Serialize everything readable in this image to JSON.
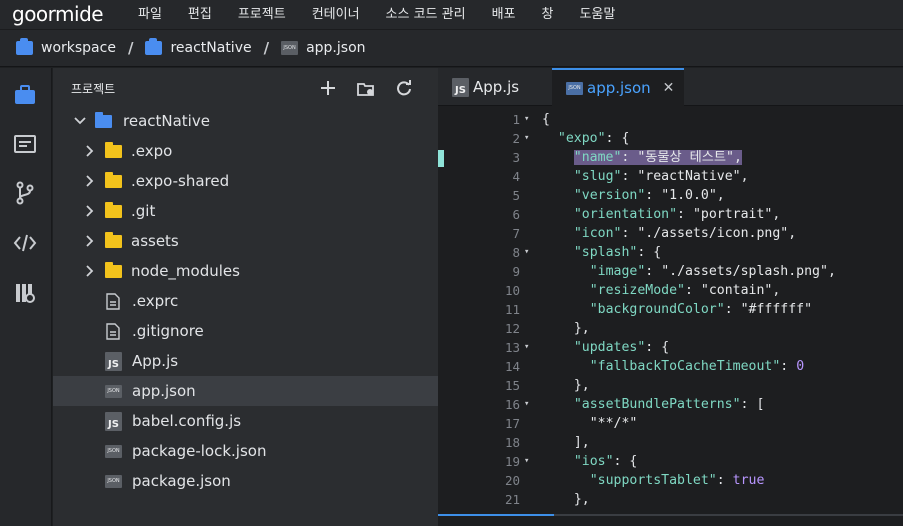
{
  "app": {
    "logo": "goormide"
  },
  "menu": [
    "파일",
    "편집",
    "프로젝트",
    "컨테이너",
    "소스 코드 관리",
    "배포",
    "창",
    "도움말"
  ],
  "breadcrumb": {
    "items": [
      "workspace",
      "reactNative",
      "app.json"
    ],
    "separator": "/"
  },
  "sidebar": {
    "title": "프로젝트",
    "tree": [
      {
        "label": "reactNative",
        "type": "root-folder",
        "expanded": true
      },
      {
        "label": ".expo",
        "type": "folder"
      },
      {
        "label": ".expo-shared",
        "type": "folder"
      },
      {
        "label": ".git",
        "type": "folder"
      },
      {
        "label": "assets",
        "type": "folder"
      },
      {
        "label": "node_modules",
        "type": "folder"
      },
      {
        "label": ".exprc",
        "type": "file"
      },
      {
        "label": ".gitignore",
        "type": "file"
      },
      {
        "label": "App.js",
        "type": "js"
      },
      {
        "label": "app.json",
        "type": "json",
        "selected": true
      },
      {
        "label": "babel.config.js",
        "type": "js"
      },
      {
        "label": "package-lock.json",
        "type": "json"
      },
      {
        "label": "package.json",
        "type": "json"
      }
    ]
  },
  "editor": {
    "tabs": [
      {
        "label": "App.js",
        "icon": "JS",
        "active": false
      },
      {
        "label": "app.json",
        "icon": "JSON",
        "active": true
      }
    ],
    "line_numbers": [
      "1",
      "2",
      "3",
      "4",
      "5",
      "6",
      "7",
      "8",
      "9",
      "10",
      "11",
      "12",
      "13",
      "14",
      "15",
      "16",
      "17",
      "18",
      "19",
      "20",
      "21"
    ],
    "lines": [
      "{",
      "  \"expo\": {",
      "    \"name\": \"동물상 테스트\",",
      "    \"slug\": \"reactNative\",",
      "    \"version\": \"1.0.0\",",
      "    \"orientation\": \"portrait\",",
      "    \"icon\": \"./assets/icon.png\",",
      "    \"splash\": {",
      "      \"image\": \"./assets/splash.png\",",
      "      \"resizeMode\": \"contain\",",
      "      \"backgroundColor\": \"#ffffff\"",
      "    },",
      "    \"updates\": {",
      "      \"fallbackToCacheTimeout\": 0",
      "    },",
      "    \"assetBundlePatterns\": [",
      "      \"**/*\"",
      "    ],",
      "    \"ios\": {",
      "      \"supportsTablet\": true",
      "    },"
    ],
    "folded_lines": [
      1,
      2,
      8,
      13,
      16,
      19
    ],
    "highlighted_line": 3
  },
  "colors": {
    "accent": "#3d8fe8",
    "folder": "#f3c31c",
    "root_folder": "#4a8df0",
    "key": "#7fd8c3",
    "number": "#b896ff",
    "highlight": "#6a5c8a"
  }
}
